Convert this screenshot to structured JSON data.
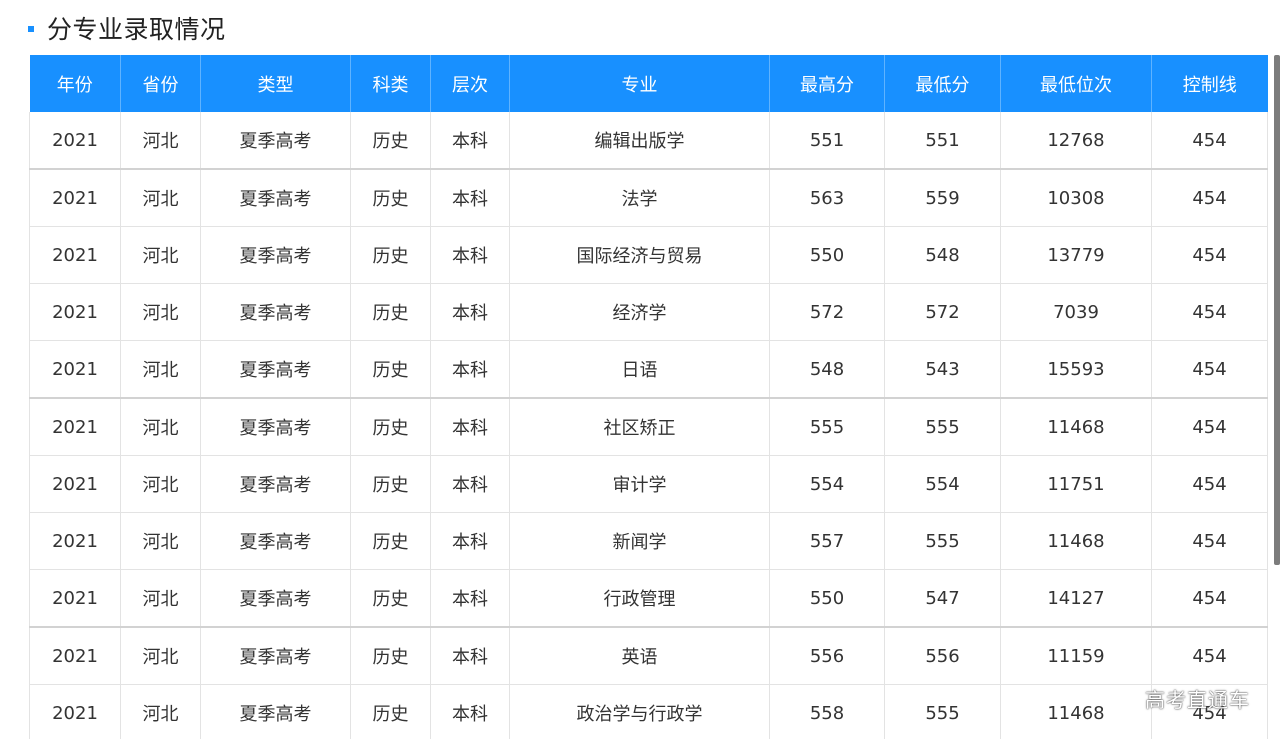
{
  "header": {
    "title": "分专业录取情况",
    "accent_color": "#1890ff"
  },
  "table": {
    "columns": [
      "年份",
      "省份",
      "类型",
      "科类",
      "层次",
      "专业",
      "最高分",
      "最低分",
      "最低位次",
      "控制线"
    ],
    "rows": [
      [
        "2021",
        "河北",
        "夏季高考",
        "历史",
        "本科",
        "编辑出版学",
        "551",
        "551",
        "12768",
        "454"
      ],
      [
        "2021",
        "河北",
        "夏季高考",
        "历史",
        "本科",
        "法学",
        "563",
        "559",
        "10308",
        "454"
      ],
      [
        "2021",
        "河北",
        "夏季高考",
        "历史",
        "本科",
        "国际经济与贸易",
        "550",
        "548",
        "13779",
        "454"
      ],
      [
        "2021",
        "河北",
        "夏季高考",
        "历史",
        "本科",
        "经济学",
        "572",
        "572",
        "7039",
        "454"
      ],
      [
        "2021",
        "河北",
        "夏季高考",
        "历史",
        "本科",
        "日语",
        "548",
        "543",
        "15593",
        "454"
      ],
      [
        "2021",
        "河北",
        "夏季高考",
        "历史",
        "本科",
        "社区矫正",
        "555",
        "555",
        "11468",
        "454"
      ],
      [
        "2021",
        "河北",
        "夏季高考",
        "历史",
        "本科",
        "审计学",
        "554",
        "554",
        "11751",
        "454"
      ],
      [
        "2021",
        "河北",
        "夏季高考",
        "历史",
        "本科",
        "新闻学",
        "557",
        "555",
        "11468",
        "454"
      ],
      [
        "2021",
        "河北",
        "夏季高考",
        "历史",
        "本科",
        "行政管理",
        "550",
        "547",
        "14127",
        "454"
      ],
      [
        "2021",
        "河北",
        "夏季高考",
        "历史",
        "本科",
        "英语",
        "556",
        "556",
        "11159",
        "454"
      ],
      [
        "2021",
        "河北",
        "夏季高考",
        "历史",
        "本科",
        "政治学与行政学",
        "558",
        "555",
        "11468",
        "454"
      ]
    ]
  },
  "watermark": {
    "text": "高考直通车"
  }
}
